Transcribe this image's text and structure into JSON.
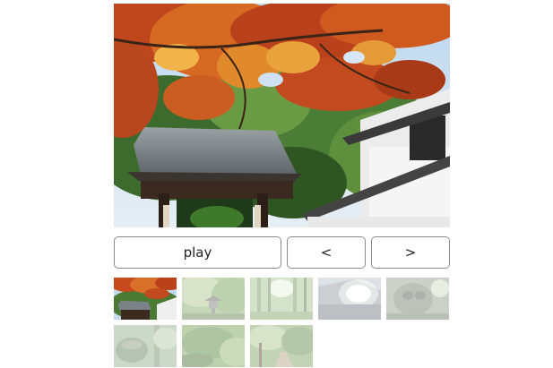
{
  "gallery": {
    "main_image": {
      "icon": "temple-gate-autumn-maple-photo"
    },
    "controls": {
      "play_label": "play",
      "prev_label": "<",
      "next_label": ">"
    },
    "thumbnails": [
      {
        "icon": "temple-gate-maple-thumbnail",
        "active": true
      },
      {
        "icon": "stone-lantern-garden-thumbnail",
        "active": false
      },
      {
        "icon": "bamboo-forest-thumbnail",
        "active": false
      },
      {
        "icon": "roof-light-flare-thumbnail",
        "active": false
      },
      {
        "icon": "stone-carving-thumbnail",
        "active": false
      },
      {
        "icon": "mossy-lantern-thumbnail",
        "active": false
      },
      {
        "icon": "green-garden-thumbnail",
        "active": false
      },
      {
        "icon": "forest-path-thumbnail",
        "active": false
      }
    ]
  }
}
